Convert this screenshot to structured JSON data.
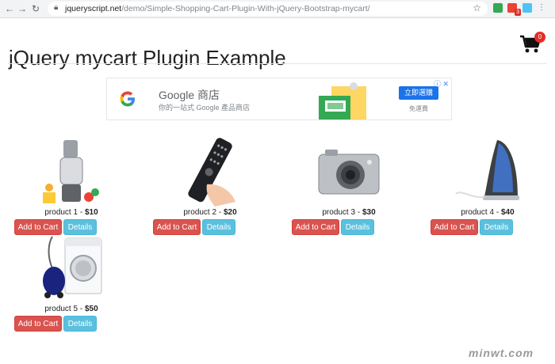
{
  "browser": {
    "url_host": "jqueryscript.net",
    "url_path": "/demo/Simple-Shopping-Cart-Plugin-With-jQuery-Bootstrap-mycart/",
    "ext_badge": "3"
  },
  "page": {
    "title": "jQuery mycart Plugin Example",
    "cart_count": "0"
  },
  "ad": {
    "title": "Google 商店",
    "subtitle": "你的一站式 Google 產品商店",
    "cta": "立即選購",
    "note": "免運費",
    "info_icon": "ⓘ ✕"
  },
  "products": [
    {
      "name": "product 1",
      "sep": " - ",
      "price": "$10",
      "add_label": "Add to Cart",
      "details_label": "Details",
      "image": "juicer"
    },
    {
      "name": "product 2",
      "sep": " - ",
      "price": "$20",
      "add_label": "Add to Cart",
      "details_label": "Details",
      "image": "remote-control"
    },
    {
      "name": "product 3",
      "sep": " - ",
      "price": "$30",
      "add_label": "Add to Cart",
      "details_label": "Details",
      "image": "camera"
    },
    {
      "name": "product 4",
      "sep": " - ",
      "price": "$40",
      "add_label": "Add to Cart",
      "details_label": "Details",
      "image": "iron"
    },
    {
      "name": "product 5",
      "sep": " - ",
      "price": "$50",
      "add_label": "Add to Cart",
      "details_label": "Details",
      "image": "washer-vacuum"
    }
  ],
  "watermark": "minwt.com",
  "colors": {
    "danger": "#d9534f",
    "info": "#5bc0de",
    "badge": "#e52d27",
    "ad_cta": "#1a73e8"
  }
}
